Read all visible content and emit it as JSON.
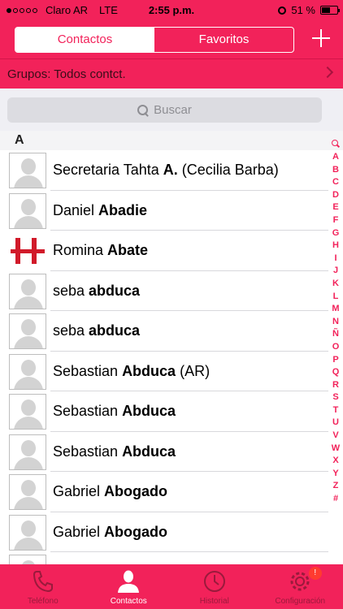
{
  "status_bar": {
    "carrier": "Claro AR",
    "network": "LTE",
    "time": "2:55 p.m.",
    "battery_text": "51 %",
    "battery_level": 0.51
  },
  "header": {
    "tabs": [
      {
        "label": "Contactos",
        "active": true
      },
      {
        "label": "Favoritos",
        "active": false
      }
    ],
    "add_icon": "plus-icon"
  },
  "groups": {
    "label": "Grupos: Todos contct.",
    "icon": "chevron-right-icon"
  },
  "search": {
    "placeholder": "Buscar",
    "icon": "search-icon"
  },
  "section": {
    "letter": "A"
  },
  "contacts": [
    {
      "first": "Secretaria Tahta ",
      "last": "A.",
      "suffix": " (Cecilia Barba)",
      "avatar": "placeholder"
    },
    {
      "first": "Daniel ",
      "last": "Abadie",
      "suffix": "",
      "avatar": "placeholder"
    },
    {
      "first": "Romina ",
      "last": "Abate",
      "suffix": "",
      "avatar": "red-logo"
    },
    {
      "first": "seba ",
      "last": "abduca",
      "suffix": "",
      "avatar": "placeholder"
    },
    {
      "first": "seba ",
      "last": "abduca",
      "suffix": "",
      "avatar": "placeholder"
    },
    {
      "first": "Sebastian ",
      "last": "Abduca",
      "suffix": " (AR)",
      "avatar": "placeholder"
    },
    {
      "first": "Sebastian ",
      "last": "Abduca",
      "suffix": "",
      "avatar": "placeholder"
    },
    {
      "first": "Sebastian ",
      "last": "Abduca",
      "suffix": "",
      "avatar": "placeholder"
    },
    {
      "first": "Gabriel ",
      "last": "Abogado",
      "suffix": "",
      "avatar": "placeholder"
    },
    {
      "first": "Gabriel ",
      "last": "Abogado",
      "suffix": "",
      "avatar": "placeholder"
    },
    {
      "first": "",
      "last": "",
      "suffix": "",
      "avatar": "placeholder"
    }
  ],
  "index_letters": [
    "A",
    "B",
    "C",
    "D",
    "E",
    "F",
    "G",
    "H",
    "I",
    "J",
    "K",
    "L",
    "M",
    "N",
    "Ñ",
    "O",
    "P",
    "Q",
    "R",
    "S",
    "T",
    "U",
    "V",
    "W",
    "X",
    "Y",
    "Z",
    "#"
  ],
  "tabbar": {
    "tabs": [
      {
        "label": "Teléfono",
        "icon": "phone-icon",
        "active": false
      },
      {
        "label": "Contactos",
        "icon": "person-icon",
        "active": true
      },
      {
        "label": "Historial",
        "icon": "clock-icon",
        "active": false
      },
      {
        "label": "Configuración",
        "icon": "gear-icon",
        "active": false,
        "badge": "!"
      }
    ]
  },
  "colors": {
    "accent": "#f2225a",
    "tab_inactive": "#9a1a3c",
    "badge": "#ff3b30"
  }
}
